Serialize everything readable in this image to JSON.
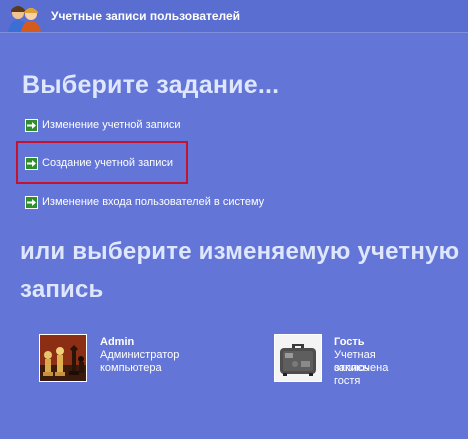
{
  "window": {
    "title": "Учетные записи пользователей",
    "icon": "users-icon"
  },
  "main": {
    "heading": "Выберите задание...",
    "tasks": [
      {
        "label": "Изменение учетной записи",
        "icon": "green-arrow-icon"
      },
      {
        "label": "Создание учетной записи",
        "icon": "green-arrow-icon",
        "highlighted": true
      },
      {
        "label": "Изменение входа пользователей в систему",
        "icon": "green-arrow-icon"
      }
    ],
    "subheading_line1": "или выберите изменяемую учетную",
    "subheading_line2": "запись"
  },
  "accounts": [
    {
      "name": "Admin",
      "description": "Администратор компьютера",
      "picture": "chess-icon"
    },
    {
      "name": "Гость",
      "description_line1": "Учетная запись гостя",
      "description_line2": "отключена",
      "picture": "suitcase-icon"
    }
  ],
  "colors": {
    "background": "#6375d6",
    "heading": "#dfe7ff",
    "highlight_border": "#c4122f",
    "arrow": "#2f8f2a"
  }
}
